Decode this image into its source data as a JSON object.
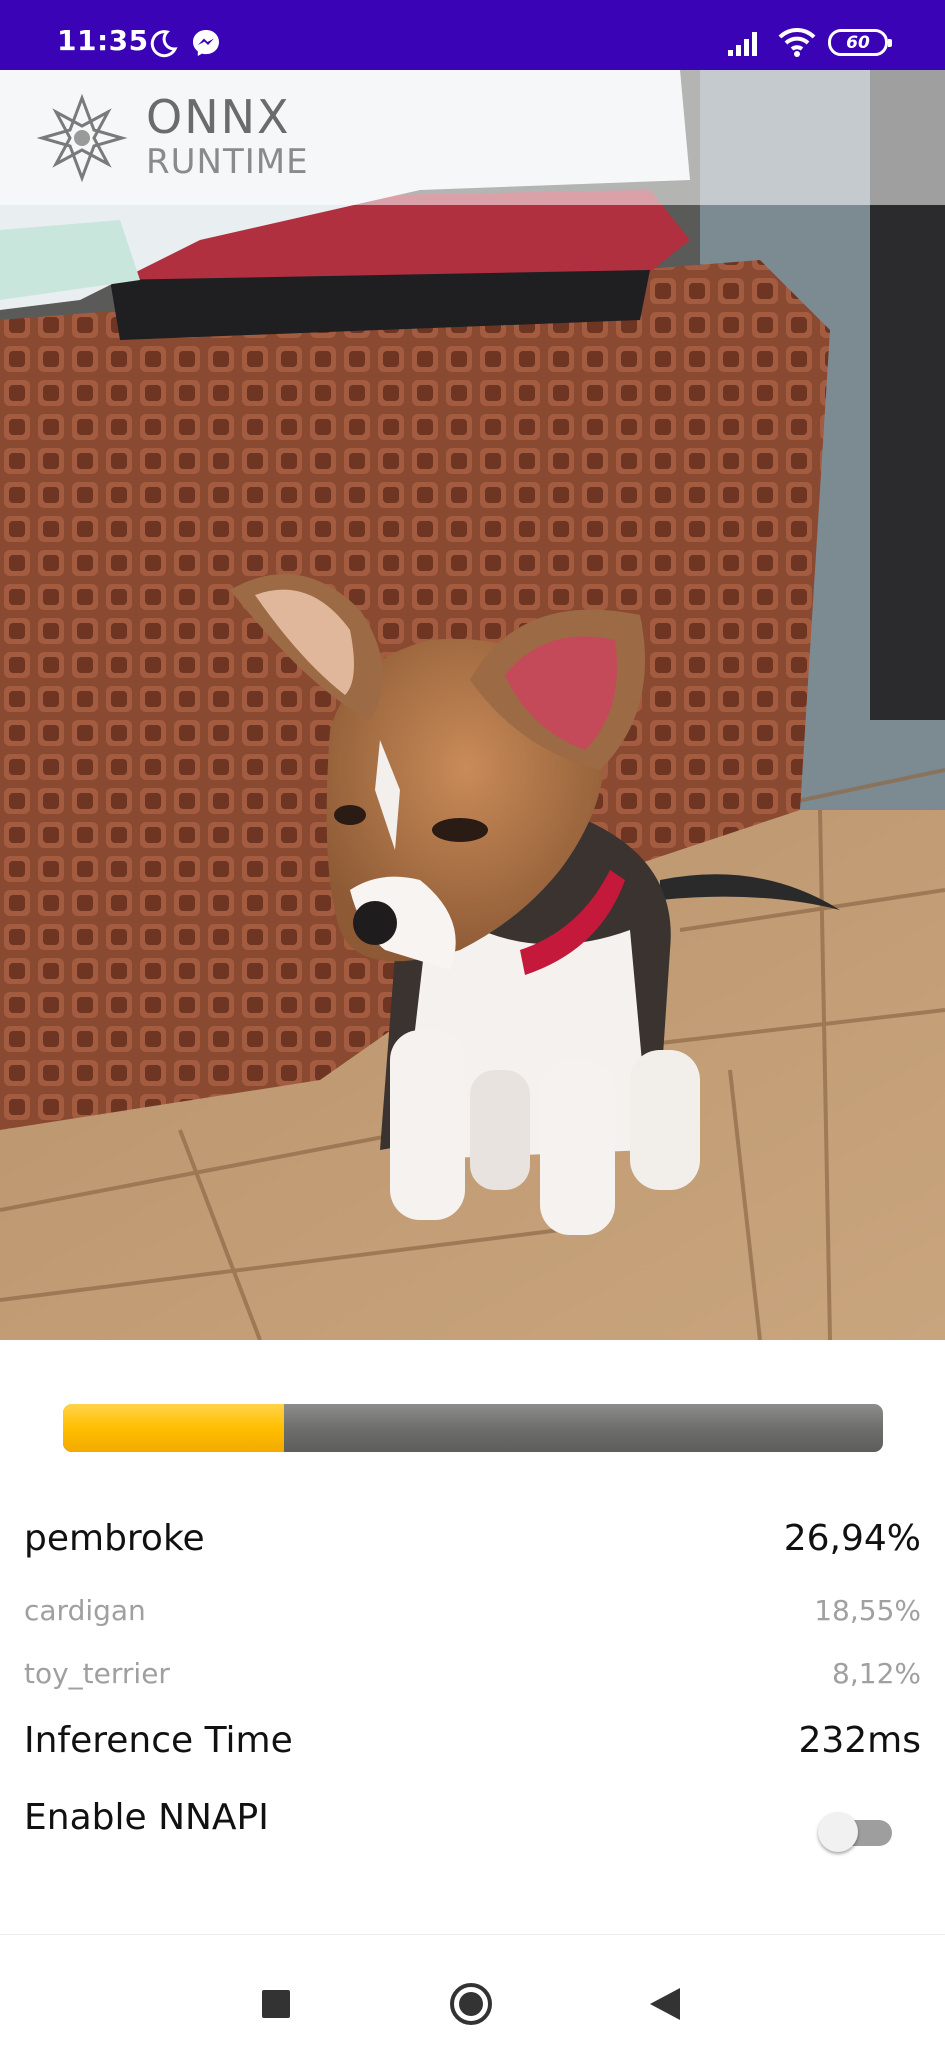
{
  "status_bar": {
    "time": "11:35",
    "battery": "60",
    "icons": [
      "moon-icon",
      "messenger-icon",
      "signal-icon",
      "wifi-icon",
      "battery-icon"
    ],
    "background": "#3a04b6"
  },
  "header": {
    "logo_line1": "ONNX",
    "logo_line2": "RUNTIME"
  },
  "progress": {
    "value_fraction": 0.2694,
    "fill_color": "#ffbf00",
    "track_color": "#6e6f6c"
  },
  "results": {
    "top": {
      "label": "pembroke",
      "value": "26,94%"
    },
    "second": {
      "label": "cardigan",
      "value": "18,55%"
    },
    "third": {
      "label": "toy_terrier",
      "value": "8,12%"
    }
  },
  "inference": {
    "label": "Inference Time",
    "value": "232ms"
  },
  "nnapi": {
    "label": "Enable NNAPI",
    "enabled": false
  },
  "nav": {
    "icons": [
      "recents-square-icon",
      "home-circle-icon",
      "back-triangle-icon"
    ]
  }
}
